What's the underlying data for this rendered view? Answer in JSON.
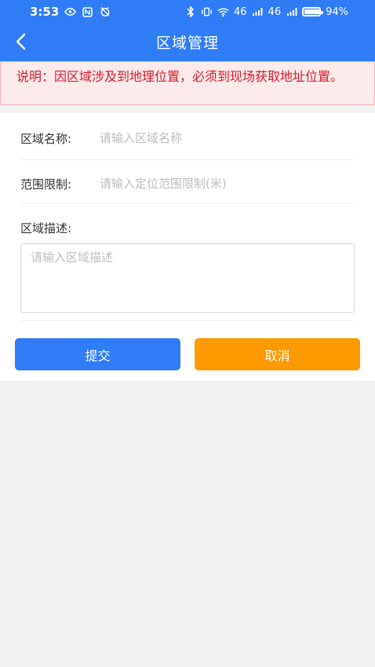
{
  "status_bar": {
    "time": "3:53",
    "battery_text": "94%",
    "battery_level": 0.94,
    "network_label_1": "46",
    "network_label_2": "46"
  },
  "header": {
    "title": "区域管理",
    "back_icon": "chevron-left-icon"
  },
  "notice": {
    "text": "说明：因区域涉及到地理位置，必须到现场获取地址位置。"
  },
  "form": {
    "name_label": "区域名称:",
    "name_placeholder": "请输入区域名称",
    "range_label": "范围限制:",
    "range_placeholder": "请输入定位范围限制(米)",
    "description_label": "区域描述:",
    "description_placeholder": "请输入区域描述"
  },
  "buttons": {
    "submit": "提交",
    "cancel": "取消"
  },
  "colors": {
    "primary": "#2f7cf6",
    "cancel": "#ff9900",
    "notice_text": "#d7192b",
    "notice_bg": "#fdeaea"
  }
}
